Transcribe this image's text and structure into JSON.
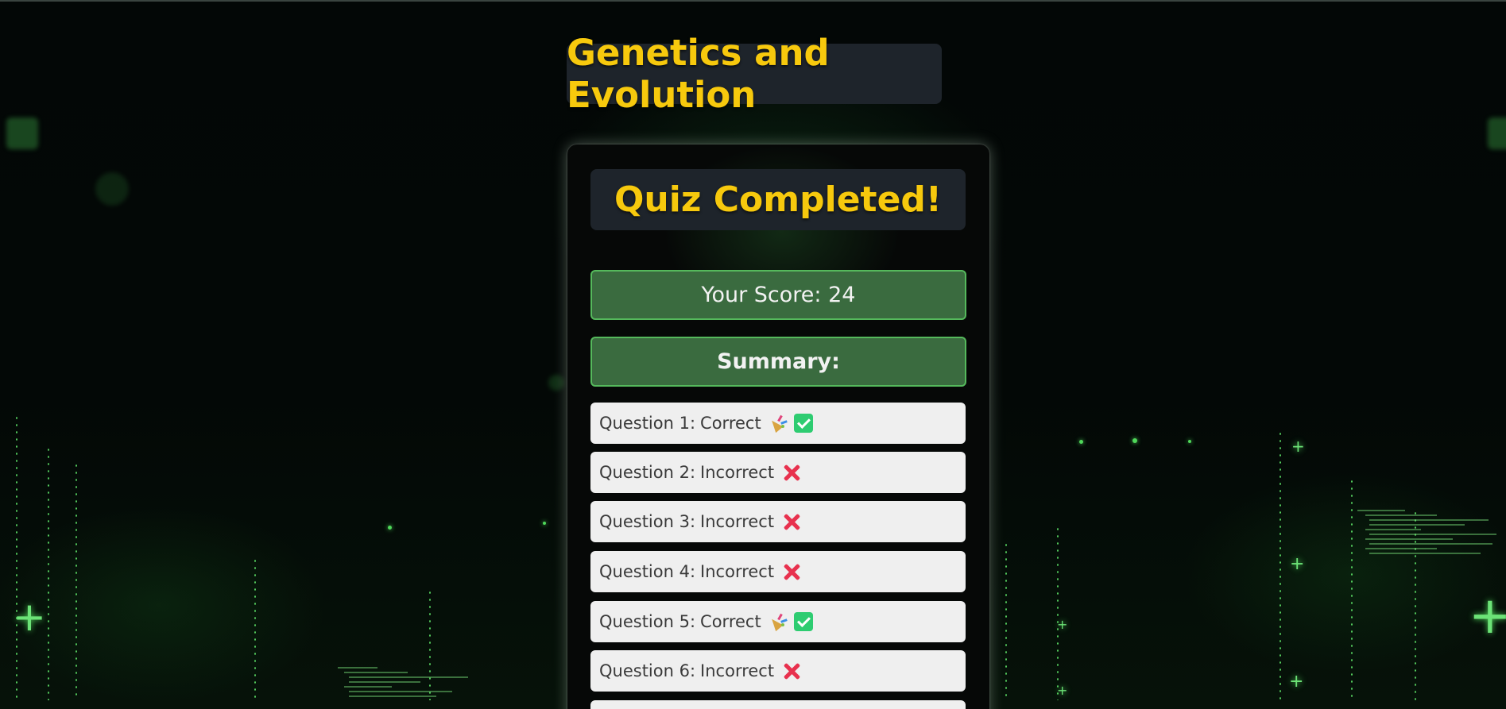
{
  "quiz": {
    "title": "Genetics and Evolution",
    "heading": "Quiz Completed!",
    "score_text": "Your Score: 24",
    "summary_label": "Summary:"
  },
  "summary": [
    {
      "label": "Question 1:",
      "result": "Correct",
      "icons": [
        "party-popper-icon",
        "check-mark-icon"
      ]
    },
    {
      "label": "Question 2:",
      "result": "Incorrect",
      "icons": [
        "cross-mark-icon"
      ]
    },
    {
      "label": "Question 3:",
      "result": "Incorrect",
      "icons": [
        "cross-mark-icon"
      ]
    },
    {
      "label": "Question 4:",
      "result": "Incorrect",
      "icons": [
        "cross-mark-icon"
      ]
    },
    {
      "label": "Question 5:",
      "result": "Correct",
      "icons": [
        "party-popper-icon",
        "check-mark-icon"
      ]
    },
    {
      "label": "Question 6:",
      "result": "Incorrect",
      "icons": [
        "cross-mark-icon"
      ]
    }
  ],
  "colors": {
    "title_yellow": "#f7c90d",
    "panel_dark": "#1e242b",
    "score_green": "#3a6b3f",
    "score_border": "#55b95c",
    "correct_check": "#2ecc71",
    "incorrect_cross": "#e8314e"
  }
}
